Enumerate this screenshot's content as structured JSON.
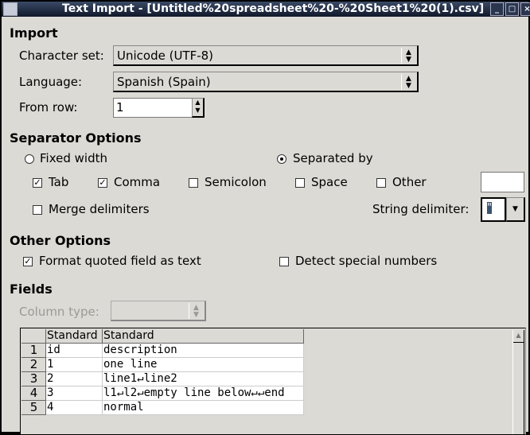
{
  "window": {
    "title": "Text Import - [Untitled%20spreadsheet%20-%20Sheet1%20(1).csv]"
  },
  "import": {
    "heading": "Import",
    "charset_label": "Character set:",
    "charset_value": "Unicode (UTF-8)",
    "language_label": "Language:",
    "language_value": "Spanish (Spain)",
    "from_row_label": "From row:",
    "from_row_value": "1"
  },
  "separator": {
    "heading": "Separator Options",
    "fixed_width": "Fixed width",
    "separated_by": "Separated by",
    "selected": "Separated by",
    "tab": {
      "label": "Tab",
      "checked": true
    },
    "comma": {
      "label": "Comma",
      "checked": true
    },
    "semicolon": {
      "label": "Semicolon",
      "checked": false
    },
    "space": {
      "label": "Space",
      "checked": false
    },
    "other": {
      "label": "Other",
      "checked": false,
      "value": ""
    },
    "merge": {
      "label": "Merge delimiters",
      "checked": false
    },
    "string_delimiter_label": "String delimiter:",
    "string_delimiter_value": "\""
  },
  "other_options": {
    "heading": "Other Options",
    "format_quoted": {
      "label": "Format quoted field as text",
      "checked": true
    },
    "detect_special": {
      "label": "Detect special numbers",
      "checked": false
    }
  },
  "fields": {
    "heading": "Fields",
    "column_type_label": "Column type:",
    "column_type_value": "",
    "columns": [
      "Standard",
      "Standard"
    ],
    "rows": [
      [
        "1",
        "id",
        "description"
      ],
      [
        "2",
        "1",
        "one line"
      ],
      [
        "3",
        "2",
        "line1↵line2"
      ],
      [
        "4",
        "3",
        "l1↵l2↵empty line below↵↵end"
      ],
      [
        "5",
        "4",
        "normal"
      ]
    ]
  }
}
